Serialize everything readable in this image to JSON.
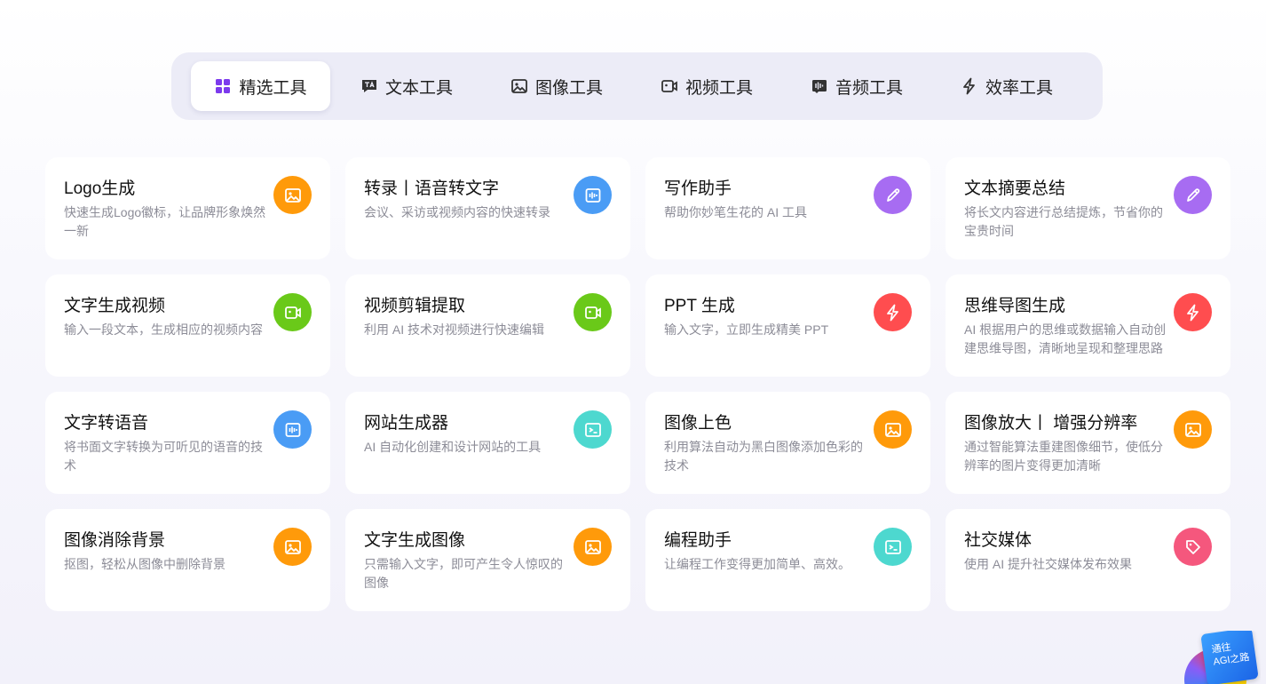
{
  "tabs": [
    {
      "label": "精选工具",
      "icon": "grid-icon",
      "active": true
    },
    {
      "label": "文本工具",
      "icon": "text-icon",
      "active": false
    },
    {
      "label": "图像工具",
      "icon": "image-icon",
      "active": false
    },
    {
      "label": "视频工具",
      "icon": "video-icon",
      "active": false
    },
    {
      "label": "音频工具",
      "icon": "audio-icon",
      "active": false
    },
    {
      "label": "效率工具",
      "icon": "lightning-icon",
      "active": false
    }
  ],
  "colors": {
    "active_tab_icon": "#7c3aed",
    "orange": "#ff9a0a",
    "blue": "#4a9cf5",
    "purple": "#a76cf2",
    "green": "#6ac919",
    "red": "#ff4d4f",
    "teal": "#4dd8cf",
    "pink": "#f5577d"
  },
  "cards": [
    {
      "title": "Logo生成",
      "desc": "快速生成Logo徽标，让品牌形象焕然一新",
      "icon": "image-icon",
      "color": "orange"
    },
    {
      "title": "转录丨语音转文字",
      "desc": "会议、采访或视频内容的快速转录",
      "icon": "audio-wave-icon",
      "color": "blue"
    },
    {
      "title": "写作助手",
      "desc": "帮助你妙笔生花的 AI 工具",
      "icon": "pencil-icon",
      "color": "purple"
    },
    {
      "title": "文本摘要总结",
      "desc": "将长文内容进行总结提炼，节省你的宝贵时间",
      "icon": "pencil-icon",
      "color": "purple"
    },
    {
      "title": "文字生成视频",
      "desc": "输入一段文本，生成相应的视频内容",
      "icon": "video-icon",
      "color": "green"
    },
    {
      "title": "视频剪辑提取",
      "desc": "利用 AI 技术对视频进行快速编辑",
      "icon": "video-icon",
      "color": "green"
    },
    {
      "title": "PPT 生成",
      "desc": "输入文字，立即生成精美 PPT",
      "icon": "lightning-icon",
      "color": "red"
    },
    {
      "title": "思维导图生成",
      "desc": "AI 根据用户的思维或数据输入自动创建思维导图，清晰地呈现和整理思路",
      "icon": "lightning-icon",
      "color": "red"
    },
    {
      "title": "文字转语音",
      "desc": "将书面文字转换为可听见的语音的技术",
      "icon": "audio-wave-icon",
      "color": "blue"
    },
    {
      "title": "网站生成器",
      "desc": "AI 自动化创建和设计网站的工具",
      "icon": "terminal-icon",
      "color": "teal"
    },
    {
      "title": "图像上色",
      "desc": "利用算法自动为黑白图像添加色彩的技术",
      "icon": "image-icon",
      "color": "orange"
    },
    {
      "title": "图像放大丨 增强分辨率",
      "desc": "通过智能算法重建图像细节，使低分辨率的图片变得更加清晰",
      "icon": "image-icon",
      "color": "orange"
    },
    {
      "title": "图像消除背景",
      "desc": "抠图，轻松从图像中删除背景",
      "icon": "image-icon",
      "color": "orange"
    },
    {
      "title": "文字生成图像",
      "desc": "只需输入文字，即可产生令人惊叹的图像",
      "icon": "image-icon",
      "color": "orange"
    },
    {
      "title": "编程助手",
      "desc": "让编程工作变得更加简单、高效。",
      "icon": "terminal-icon",
      "color": "teal"
    },
    {
      "title": "社交媒体",
      "desc": "使用 AI 提升社交媒体发布效果",
      "icon": "tag-icon",
      "color": "pink"
    }
  ],
  "badge": {
    "line1": "通往",
    "line2": "AGI之路"
  }
}
